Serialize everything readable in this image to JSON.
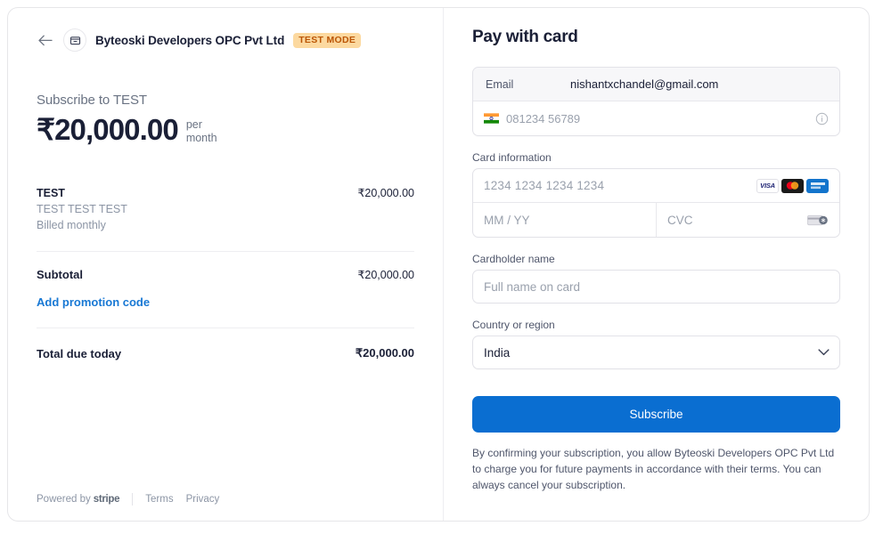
{
  "summary": {
    "back_icon": "back-arrow-icon",
    "merchant_logo_icon": "merchant-box-icon",
    "merchant_name": "Byteoski Developers OPC Pvt Ltd",
    "test_badge": "TEST MODE",
    "subscribe_heading": "Subscribe to TEST",
    "price_amount": "₹20,000.00",
    "price_period_line1": "per",
    "price_period_line2": "month",
    "line_item": {
      "name": "TEST",
      "description": "TEST TEST TEST",
      "billing": "Billed monthly",
      "amount": "₹20,000.00"
    },
    "subtotal_label": "Subtotal",
    "subtotal_amount": "₹20,000.00",
    "promo_link": "Add promotion code",
    "total_label": "Total due today",
    "total_amount": "₹20,000.00",
    "footer": {
      "powered_by": "Powered by",
      "stripe": "stripe",
      "terms": "Terms",
      "privacy": "Privacy"
    }
  },
  "payment": {
    "title": "Pay with card",
    "email_label": "Email",
    "email_value": "nishantxchandel@gmail.com",
    "phone_placeholder": "081234 56789",
    "phone_flag_icon": "india-flag-icon",
    "phone_info_icon": "info-circle-icon",
    "card_information_label": "Card information",
    "card_number_placeholder": "1234 1234 1234 1234",
    "brands": [
      {
        "name": "visa-card-icon",
        "label": "VISA"
      },
      {
        "name": "mastercard-card-icon",
        "label": ""
      },
      {
        "name": "rupay-card-icon",
        "label": ""
      }
    ],
    "expiry_placeholder": "MM / YY",
    "cvc_placeholder": "CVC",
    "cvc_icon": "cvc-card-icon",
    "cardholder_label": "Cardholder name",
    "cardholder_placeholder": "Full name on card",
    "cardholder_value": "",
    "country_label": "Country or region",
    "country_value": "India",
    "country_chevron_icon": "chevron-down-icon",
    "submit_label": "Subscribe",
    "terms_text": "By confirming your subscription, you allow Byteoski Developers OPC Pvt Ltd to charge you for future payments in accordance with their terms. You can always cancel your subscription."
  },
  "colors": {
    "accent_blue": "#0a6ed1",
    "link_blue": "#1878d4",
    "badge_bg": "#fcd9a0",
    "badge_text": "#bb5504",
    "text_dark": "#1a1f36",
    "text_muted": "#6a7383"
  }
}
